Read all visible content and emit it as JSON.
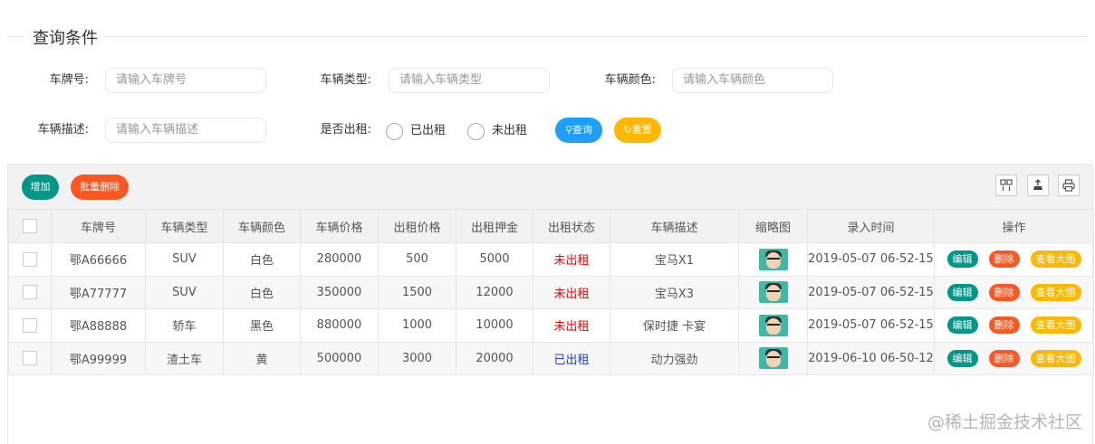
{
  "fieldset": {
    "title": "查询条件"
  },
  "form": {
    "plate_label": "车牌号:",
    "plate_placeholder": "请输入车牌号",
    "type_label": "车辆类型:",
    "type_placeholder": "请输入车辆类型",
    "color_label": "车辆颜色:",
    "color_placeholder": "请输入车辆颜色",
    "desc_label": "车辆描述:",
    "desc_placeholder": "请输入车辆描述",
    "rented_label": "是否出租:",
    "rented_yes": "已出租",
    "rented_no": "未出租",
    "search_label": "查询",
    "reset_label": "重置"
  },
  "toolbar": {
    "add_label": "增加",
    "batch_delete_label": "批量删除",
    "icons": [
      "columns-icon",
      "export-icon",
      "print-icon"
    ]
  },
  "table": {
    "headers": [
      "车牌号",
      "车辆类型",
      "车辆颜色",
      "车辆价格",
      "出租价格",
      "出租押金",
      "出租状态",
      "车辆描述",
      "缩略图",
      "录入时间",
      "操作"
    ],
    "actions": {
      "edit": "编辑",
      "delete": "删除",
      "view": "查看大图"
    },
    "rows": [
      {
        "plate": "鄂A66666",
        "type": "SUV",
        "color": "白色",
        "price": "280000",
        "rent_price": "500",
        "deposit": "5000",
        "status": "未出租",
        "desc": "宝马X1",
        "time": "2019-05-07 06-52-15"
      },
      {
        "plate": "鄂A77777",
        "type": "SUV",
        "color": "白色",
        "price": "350000",
        "rent_price": "1500",
        "deposit": "12000",
        "status": "未出租",
        "desc": "宝马X3",
        "time": "2019-05-07 06-52-15"
      },
      {
        "plate": "鄂A88888",
        "type": "轿车",
        "color": "黑色",
        "price": "880000",
        "rent_price": "1000",
        "deposit": "10000",
        "status": "未出租",
        "desc": "保时捷 卡宴",
        "time": "2019-05-07 06-52-15"
      },
      {
        "plate": "鄂A99999",
        "type": "渣土车",
        "color": "黄",
        "price": "500000",
        "rent_price": "3000",
        "deposit": "20000",
        "status": "已出租",
        "desc": "动力强劲",
        "time": "2019-06-10 06-50-12"
      }
    ]
  },
  "colors": {
    "teal": "#009688",
    "orange": "#ff5722",
    "blue": "#1e9fff",
    "yellow": "#ffb800",
    "status_not_rented": "#ee0000",
    "status_rented": "#1d3fcf"
  },
  "watermark": "@稀土掘金技术社区"
}
